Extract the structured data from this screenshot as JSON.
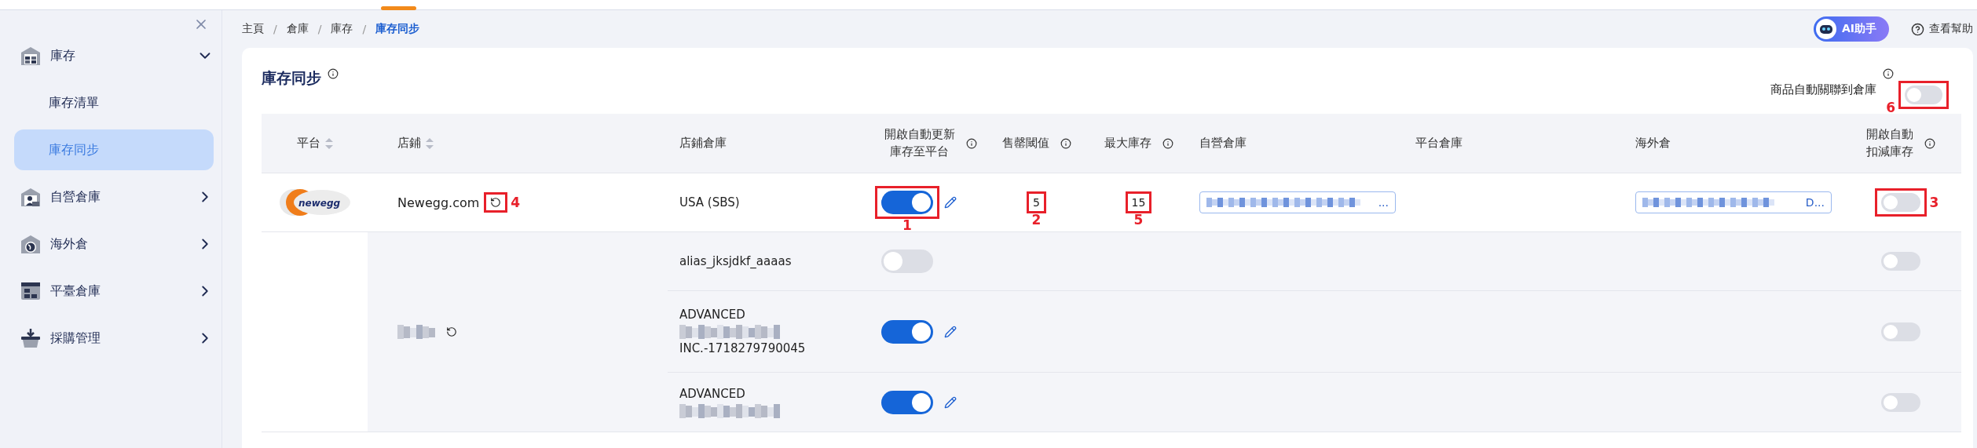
{
  "sidebar": {
    "items": [
      {
        "label": "庫存",
        "kind": "warehouse",
        "expanded": true,
        "children": [
          {
            "label": "庫存清單",
            "selected": false
          },
          {
            "label": "庫存同步",
            "selected": true
          }
        ]
      },
      {
        "label": "自營倉庫",
        "kind": "person",
        "expanded": false
      },
      {
        "label": "海外倉",
        "kind": "globe",
        "expanded": false
      },
      {
        "label": "平臺倉庫",
        "kind": "layout",
        "expanded": false
      },
      {
        "label": "採購管理",
        "kind": "basket",
        "expanded": false
      }
    ]
  },
  "breadcrumb_separator": "/",
  "breadcrumb": [
    {
      "label": "主頁",
      "selected": false
    },
    {
      "label": "倉庫",
      "selected": false
    },
    {
      "label": "庫存",
      "selected": false
    },
    {
      "label": "庫存同步",
      "selected": true
    }
  ],
  "header_actions": {
    "ai_button": "AI助手",
    "help": "查看幫助"
  },
  "page": {
    "title": "庫存同步",
    "auto_link": {
      "label": "商品自動關聯到倉庫",
      "on": false,
      "marker": "6"
    }
  },
  "table": {
    "columns": [
      {
        "label": "平台",
        "sortable": true
      },
      {
        "label": "店鋪",
        "sortable": true
      },
      {
        "label": "店鋪倉庫"
      },
      {
        "label": "開啟自動更新庫存至平台",
        "info": true
      },
      {
        "label": "售罄閾值",
        "info": true
      },
      {
        "label": "最大庫存",
        "info": true
      },
      {
        "label": "自營倉庫"
      },
      {
        "label": "平台倉庫"
      },
      {
        "label": "海外倉"
      },
      {
        "label": "開啟自動扣減庫存",
        "info": true
      }
    ],
    "groups": [
      {
        "platform_logo": "newegg",
        "store": "Newegg.com",
        "store_marker": "4",
        "rows": [
          {
            "warehouse": "USA (SBS)",
            "auto_update": true,
            "auto_update_marker": "1",
            "editable": true,
            "threshold": "5",
            "threshold_marker": "2",
            "max_stock": "15",
            "max_stock_marker": "5",
            "own_warehouse": "...",
            "overseas": "D...",
            "auto_deduct": false,
            "auto_deduct_marker": "3"
          }
        ]
      },
      {
        "store_redacted": true,
        "rows": [
          {
            "warehouse": "alias_jksjdkf_aaaas",
            "auto_update": false,
            "auto_deduct": false
          },
          {
            "warehouse": "ADVANCED",
            "warehouse_redacted": true,
            "warehouse_tail": "INC.-1718279790045",
            "auto_update": true,
            "editable": true,
            "auto_deduct": false
          },
          {
            "warehouse": "ADVANCED",
            "warehouse_redacted": true,
            "auto_update": true,
            "editable": true,
            "auto_deduct": false
          }
        ]
      }
    ]
  }
}
